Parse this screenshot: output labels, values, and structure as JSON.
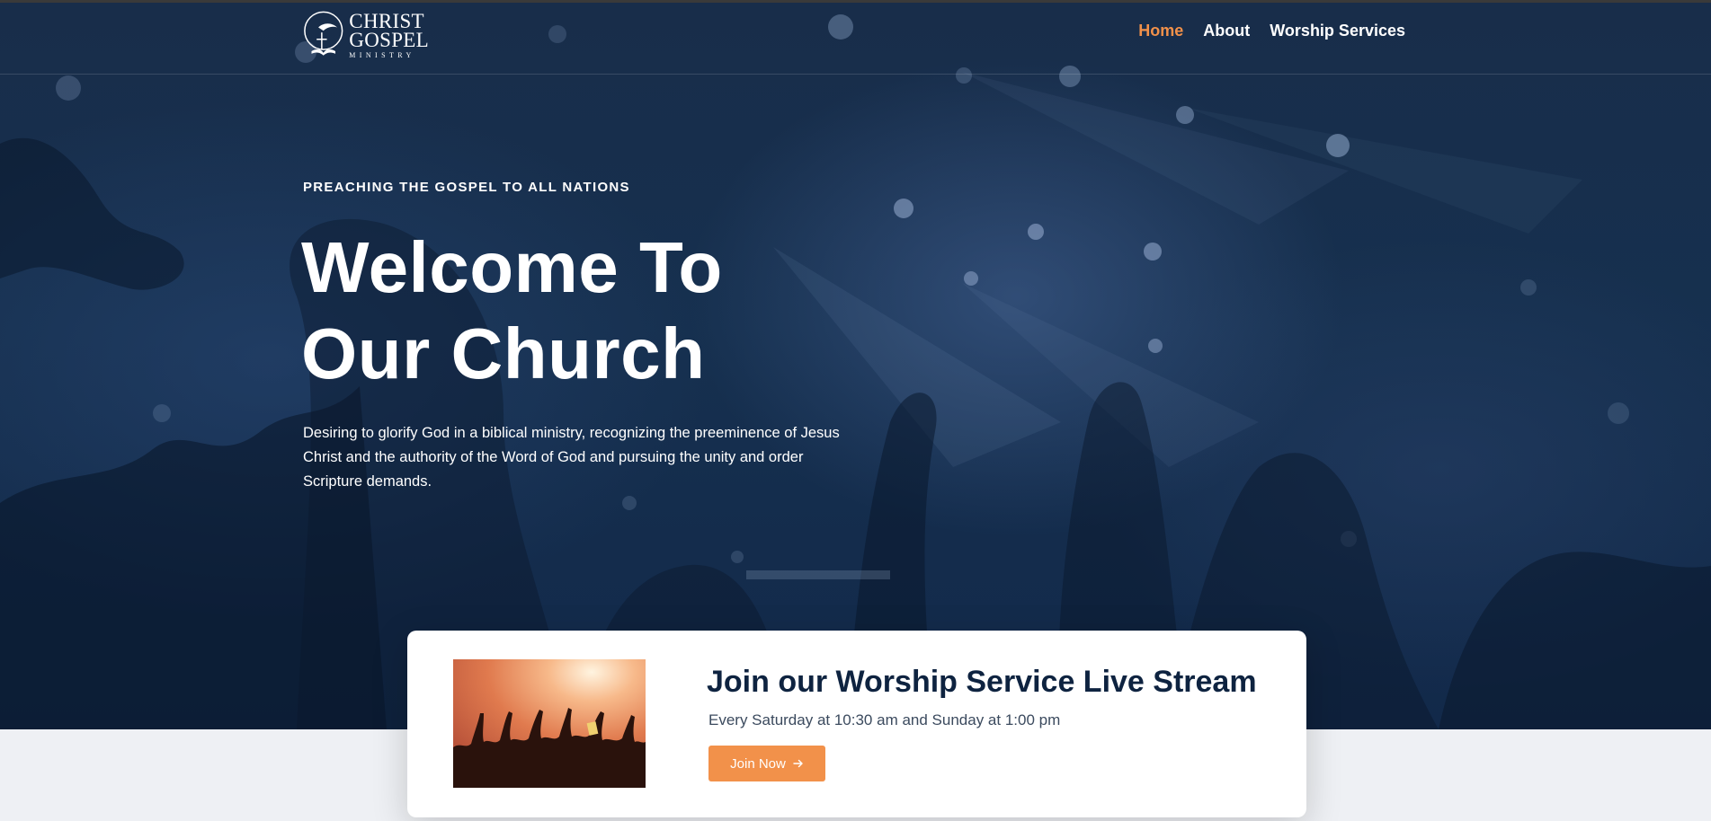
{
  "brand": {
    "line1": "CHRIST",
    "line2": "GOSPEL",
    "line3": "MINISTRY",
    "icon": "dove-cross-book-icon"
  },
  "nav": {
    "items": [
      {
        "label": "Home",
        "active": true
      },
      {
        "label": "About",
        "active": false
      },
      {
        "label": "Worship Services",
        "active": false
      }
    ]
  },
  "hero": {
    "eyebrow": "PREACHING THE GOSPEL TO ALL NATIONS",
    "title_line1": "Welcome To",
    "title_line2": "Our Church",
    "lead": "Desiring to glorify God in a biblical ministry, recognizing the preeminence of Jesus Christ and the authority of the Word of God and pursuing the unity and order Scripture demands."
  },
  "livestream": {
    "title": "Join our Worship Service Live Stream",
    "schedule": "Every Saturday at 10:30 am and Sunday at 1:00 pm",
    "button_label": "Join Now",
    "button_icon": "arrow-right-icon"
  },
  "colors": {
    "accent": "#f2914a",
    "hero_bg": "#16304f",
    "heading_dark": "#0e2340"
  }
}
